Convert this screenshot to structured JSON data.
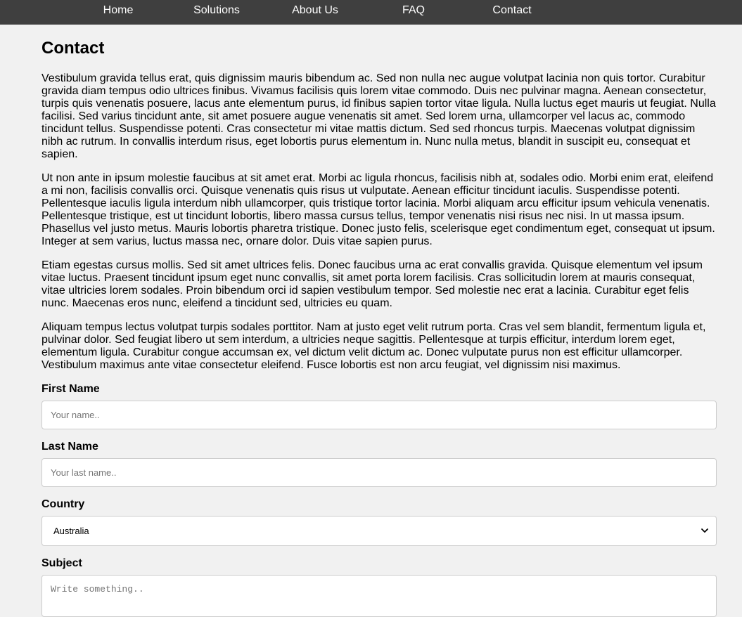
{
  "nav": {
    "items": [
      {
        "label": "Home"
      },
      {
        "label": "Solutions"
      },
      {
        "label": "About Us"
      },
      {
        "label": "FAQ"
      },
      {
        "label": "Contact"
      }
    ]
  },
  "main": {
    "title": "Contact",
    "paragraphs": [
      "Vestibulum gravida tellus erat, quis dignissim mauris bibendum ac. Sed non nulla nec augue volutpat lacinia non quis tortor. Curabitur gravida diam tempus odio ultrices finibus. Vivamus facilisis quis lorem vitae commodo. Duis nec pulvinar magna. Aenean consectetur, turpis quis venenatis posuere, lacus ante elementum purus, id finibus sapien tortor vitae ligula. Nulla luctus eget mauris ut feugiat. Nulla facilisi. Sed varius tincidunt ante, sit amet posuere augue venenatis sit amet. Sed lorem urna, ullamcorper vel lacus ac, commodo tincidunt tellus. Suspendisse potenti. Cras consectetur mi vitae mattis dictum. Sed sed rhoncus turpis. Maecenas volutpat dignissim nibh ac rutrum. In convallis interdum risus, eget lobortis purus elementum in. Nunc nulla metus, blandit in suscipit eu, consequat et sapien.",
      "Ut non ante in ipsum molestie faucibus at sit amet erat. Morbi ac ligula rhoncus, facilisis nibh at, sodales odio. Morbi enim erat, eleifend a mi non, facilisis convallis orci. Quisque venenatis quis risus ut vulputate. Aenean efficitur tincidunt iaculis. Suspendisse potenti. Pellentesque iaculis ligula interdum nibh ullamcorper, quis tristique tortor lacinia. Morbi aliquam arcu efficitur ipsum vehicula venenatis. Pellentesque tristique, est ut tincidunt lobortis, libero massa cursus tellus, tempor venenatis nisi risus nec nisi. In ut massa ipsum. Phasellus vel justo metus. Mauris lobortis pharetra tristique. Donec justo felis, scelerisque eget condimentum eget, consequat ut ipsum. Integer at sem varius, luctus massa nec, ornare dolor. Duis vitae sapien purus.",
      "Etiam egestas cursus mollis. Sed sit amet ultrices felis. Donec faucibus urna ac erat convallis gravida. Quisque elementum vel ipsum vitae luctus. Praesent tincidunt ipsum eget nunc convallis, sit amet porta lorem facilisis. Cras sollicitudin lorem at mauris consequat, vitae ultricies lorem sodales. Proin bibendum orci id sapien vestibulum tempor. Sed molestie nec erat a lacinia. Curabitur eget felis nunc. Maecenas eros nunc, eleifend a tincidunt sed, ultricies eu quam.",
      "Aliquam tempus lectus volutpat turpis sodales porttitor. Nam at justo eget velit rutrum porta. Cras vel sem blandit, fermentum ligula et, pulvinar dolor. Sed feugiat libero ut sem interdum, a ultricies neque sagittis. Pellentesque at turpis efficitur, interdum lorem eget, elementum ligula. Curabitur congue accumsan ex, vel dictum velit dictum ac. Donec vulputate purus non est efficitur ullamcorper. Vestibulum maximus ante vitae consectetur eleifend. Fusce lobortis est non arcu feugiat, vel dignissim nisi maximus."
    ]
  },
  "form": {
    "first_name": {
      "label": "First Name",
      "value": "",
      "placeholder": "Your name.."
    },
    "last_name": {
      "label": "Last Name",
      "value": "",
      "placeholder": "Your last name.."
    },
    "country": {
      "label": "Country",
      "selected": "Australia"
    },
    "subject": {
      "label": "Subject",
      "value": "",
      "placeholder": "Write something.."
    }
  },
  "icons": {
    "select_chevron": "chevron-down-icon"
  },
  "colors": {
    "nav_bg": "#3f3f3f",
    "page_bg": "#f1f1f1",
    "input_border": "#cccccc"
  }
}
